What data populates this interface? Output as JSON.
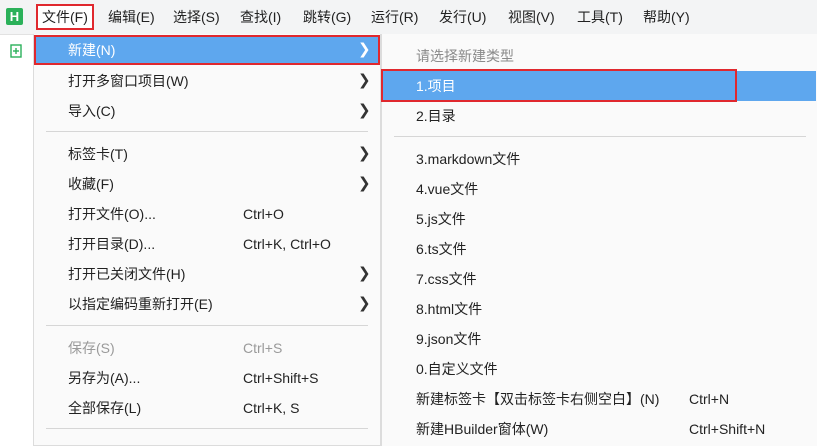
{
  "menubar": {
    "logo": "H",
    "items": [
      {
        "label": "文件(F)"
      },
      {
        "label": "编辑(E)"
      },
      {
        "label": "选择(S)"
      },
      {
        "label": "查找(I)"
      },
      {
        "label": "跳转(G)"
      },
      {
        "label": "运行(R)"
      },
      {
        "label": "发行(U)"
      },
      {
        "label": "视图(V)"
      },
      {
        "label": "工具(T)"
      },
      {
        "label": "帮助(Y)"
      }
    ]
  },
  "file_menu": {
    "items": [
      {
        "label": "新建(N)",
        "shortcut": ""
      },
      {
        "label": "打开多窗口项目(W)",
        "shortcut": ""
      },
      {
        "label": "导入(C)",
        "shortcut": ""
      },
      {
        "label": "标签卡(T)",
        "shortcut": ""
      },
      {
        "label": "收藏(F)",
        "shortcut": ""
      },
      {
        "label": "打开文件(O)...",
        "shortcut": "Ctrl+O"
      },
      {
        "label": "打开目录(D)...",
        "shortcut": "Ctrl+K, Ctrl+O"
      },
      {
        "label": "打开已关闭文件(H)",
        "shortcut": ""
      },
      {
        "label": "以指定编码重新打开(E)",
        "shortcut": ""
      },
      {
        "label": "保存(S)",
        "shortcut": "Ctrl+S"
      },
      {
        "label": "另存为(A)...",
        "shortcut": "Ctrl+Shift+S"
      },
      {
        "label": "全部保存(L)",
        "shortcut": "Ctrl+K, S"
      }
    ]
  },
  "new_submenu": {
    "header": "请选择新建类型",
    "items": [
      {
        "label": "1.项目",
        "shortcut": ""
      },
      {
        "label": "2.目录",
        "shortcut": ""
      },
      {
        "label": "3.markdown文件",
        "shortcut": ""
      },
      {
        "label": "4.vue文件",
        "shortcut": ""
      },
      {
        "label": "5.js文件",
        "shortcut": ""
      },
      {
        "label": "6.ts文件",
        "shortcut": ""
      },
      {
        "label": "7.css文件",
        "shortcut": ""
      },
      {
        "label": "8.html文件",
        "shortcut": ""
      },
      {
        "label": "9.json文件",
        "shortcut": ""
      },
      {
        "label": "0.自定义文件",
        "shortcut": ""
      },
      {
        "label": "新建标签卡【双击标签卡右侧空白】(N)",
        "shortcut": "Ctrl+N"
      },
      {
        "label": "新建HBuilder窗体(W)",
        "shortcut": "Ctrl+Shift+N"
      }
    ]
  },
  "colors": {
    "highlight": "#5ea7ee",
    "annotation": "#e0282e",
    "disabled_text": "#9a9a9a"
  }
}
